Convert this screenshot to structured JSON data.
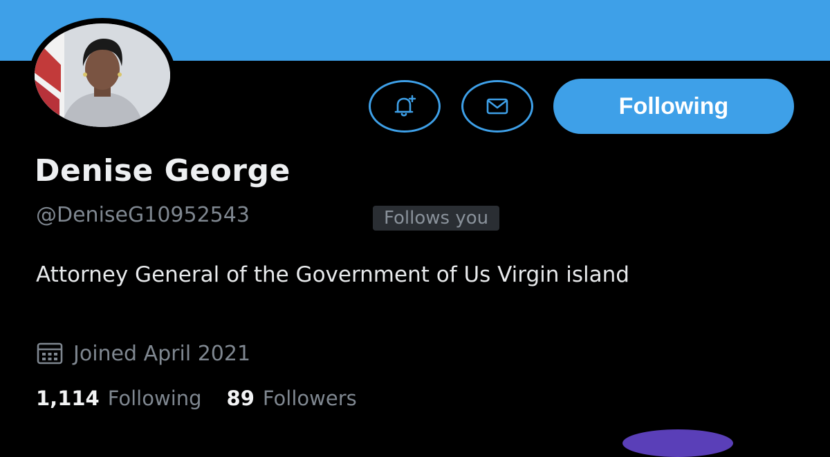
{
  "profile": {
    "display_name": "Denise George",
    "handle": "@DeniseG10952543",
    "follows_you_badge": "Follows you",
    "bio": "Attorney General of the Government of Us Virgin island",
    "joined": "Joined April 2021",
    "avatar_icon": "profile-photo"
  },
  "actions": {
    "notify_icon": "bell-plus-icon",
    "message_icon": "mail-icon",
    "follow_label": "Following"
  },
  "stats": {
    "following_count": "1,114",
    "following_label": "Following",
    "followers_count": "89",
    "followers_label": "Followers"
  },
  "colors": {
    "accent": "#3ea0e8",
    "background": "#000000",
    "muted_text": "#7f8790"
  }
}
